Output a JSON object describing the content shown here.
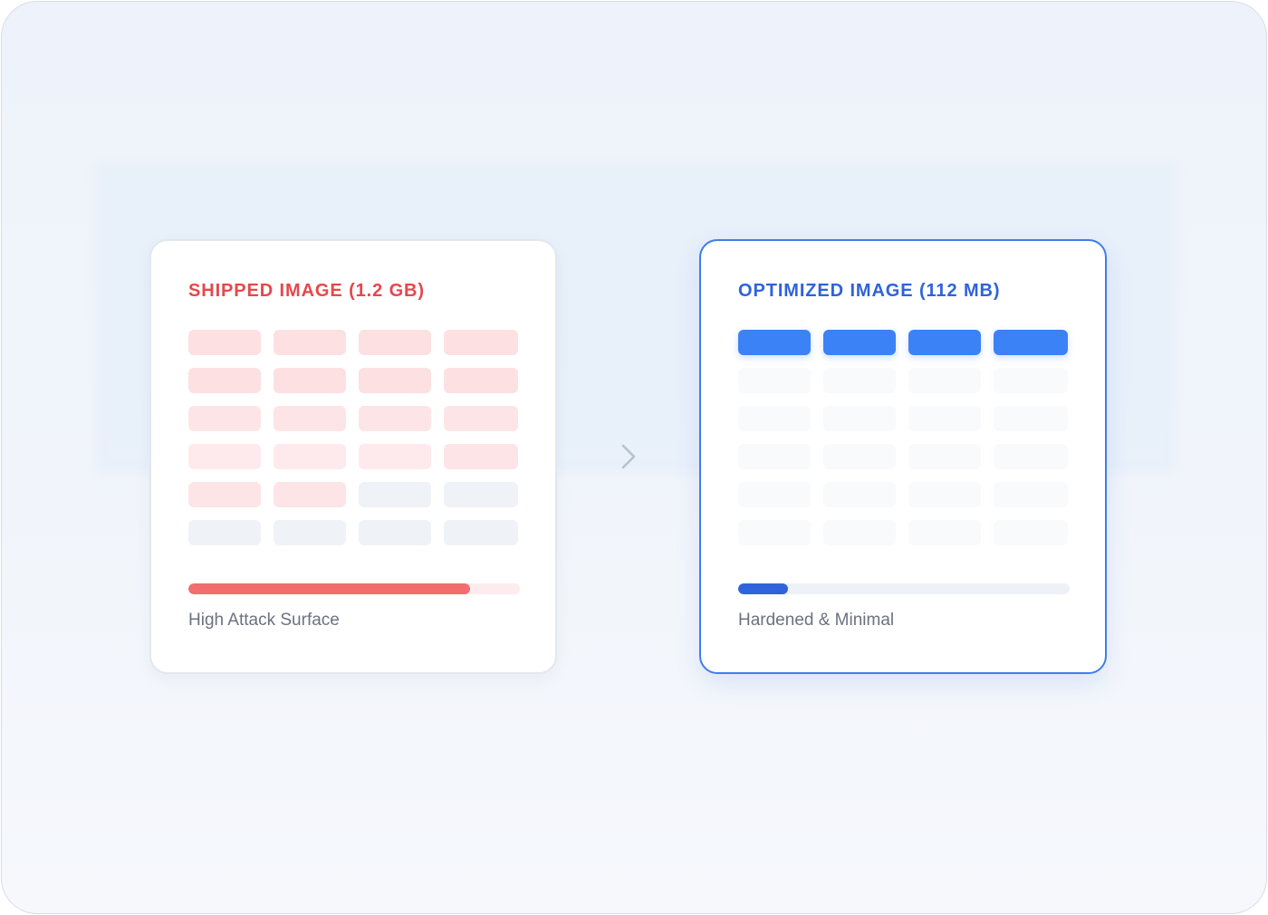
{
  "cards": {
    "shipped": {
      "title": "SHIPPED IMAGE (1.2 GB)",
      "caption": "High Attack Surface",
      "bar_fill": 0.85,
      "accent": "#e5484d",
      "bar_color": "#f26d6d",
      "blocks": [
        [
          "r1",
          "r1",
          "r1",
          "r1"
        ],
        [
          "r1",
          "r1",
          "r1",
          "r1"
        ],
        [
          "r2",
          "r2",
          "r2",
          "r2"
        ],
        [
          "r3",
          "r3",
          "r3",
          "r2"
        ],
        [
          "r2",
          "r2",
          "g",
          "g"
        ],
        [
          "g",
          "g",
          "g",
          "g"
        ]
      ]
    },
    "optimized": {
      "title": "OPTIMIZED IMAGE (112 MB)",
      "caption": "Hardened & Minimal",
      "bar_fill": 0.15,
      "accent": "#2f63dc",
      "bar_color": "#2f63dc",
      "blocks": [
        [
          "b",
          "b",
          "b",
          "b"
        ],
        [
          "e",
          "e",
          "e",
          "e"
        ],
        [
          "e",
          "e",
          "e",
          "e"
        ],
        [
          "e",
          "e",
          "e",
          "e"
        ],
        [
          "e",
          "e",
          "e",
          "e"
        ],
        [
          "e",
          "e",
          "e",
          "e"
        ]
      ]
    }
  },
  "arrow_icon": "chevron-right-icon"
}
